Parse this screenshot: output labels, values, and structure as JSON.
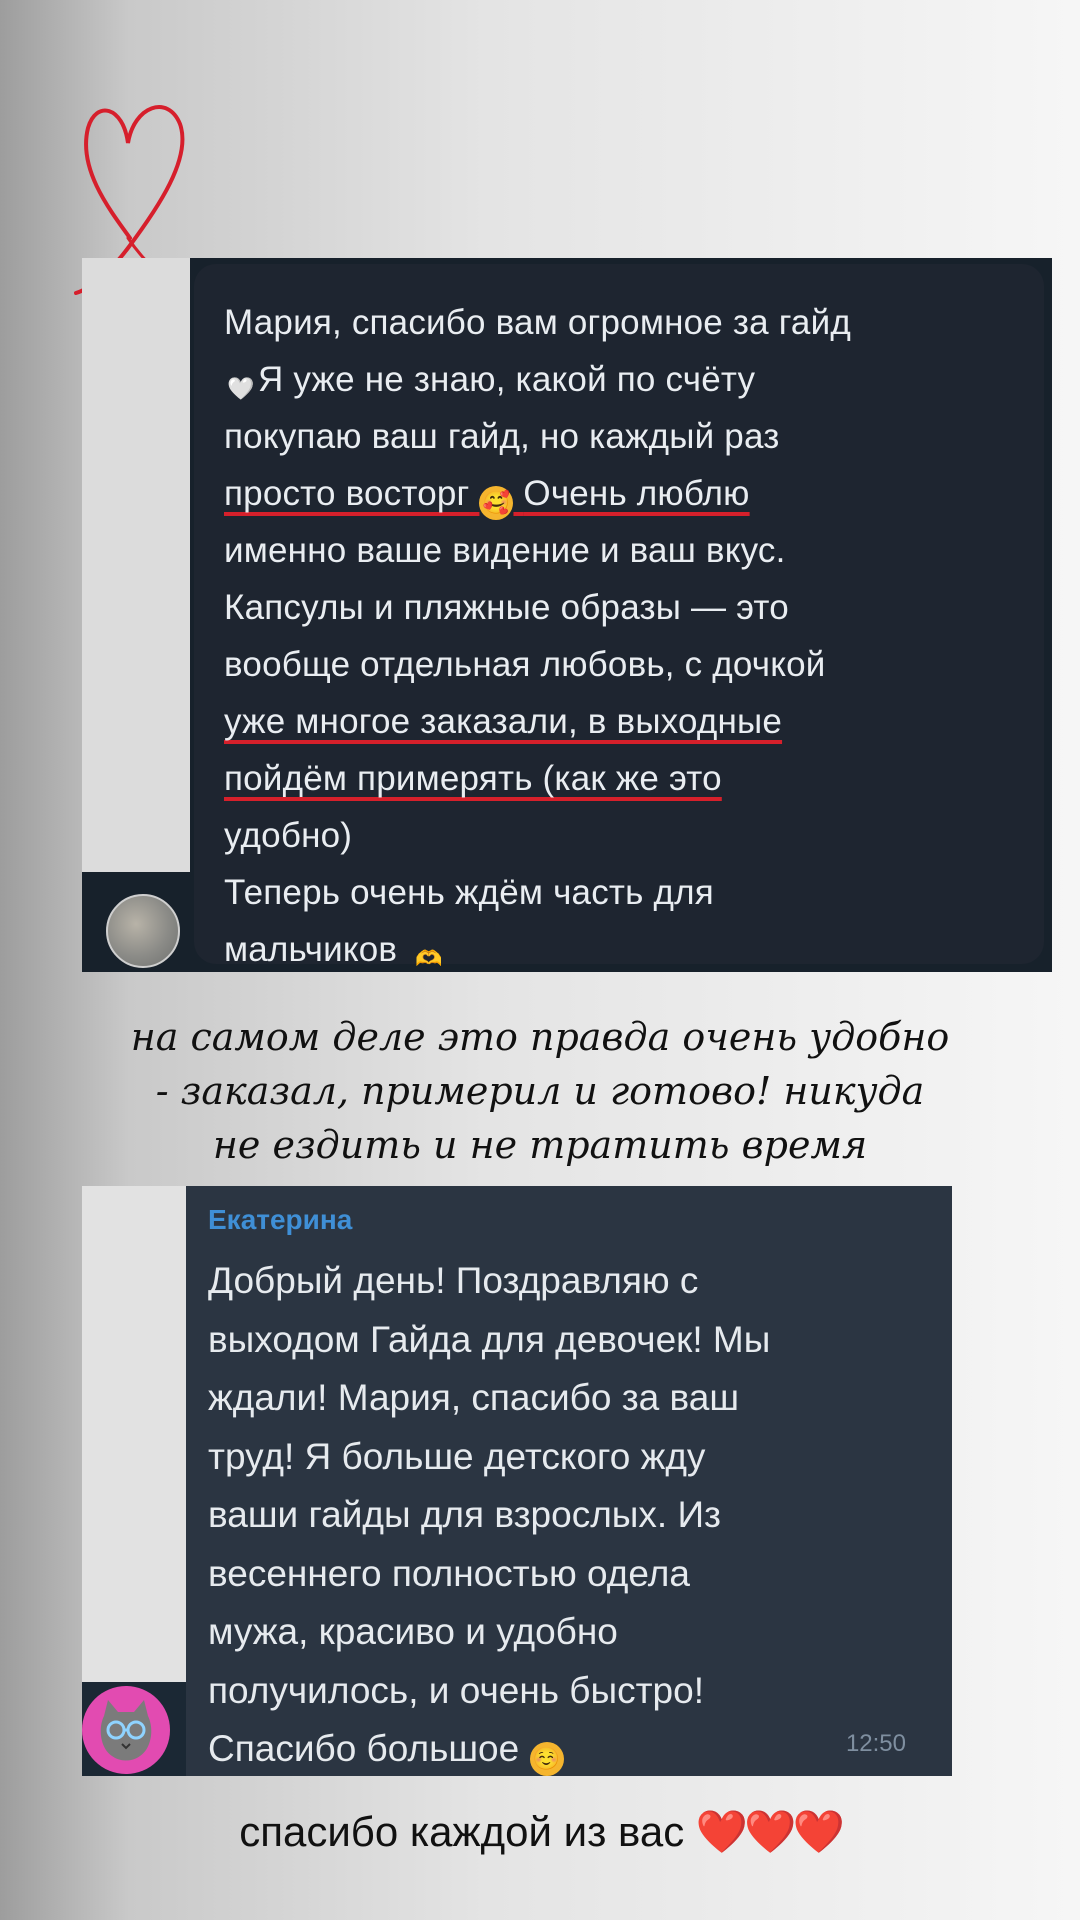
{
  "message1": {
    "lines": [
      "Мария, спасибо вам огромное за гайд",
      "Я уже не знаю, какой по счёту",
      "покупаю ваш гайд, но каждый раз",
      "просто восторг",
      "Очень люблю",
      "именно ваше видение и ваш вкус.",
      "Капсулы и пляжные образы — это",
      "вообще отдельная любовь, с дочкой",
      "уже многое заказали, в выходные",
      "пойдём примерять (как же это",
      "удобно)",
      "Теперь очень ждём часть для",
      "мальчиков"
    ],
    "emoji": {
      "heart": "🤍",
      "smile": "🥰",
      "hands": "🫶"
    }
  },
  "handwriting": {
    "lines": [
      "на самом деле это правда очень удобно",
      "- заказал, примерил и готово! никуда",
      "не ездить и не тратить время"
    ]
  },
  "message2": {
    "sender": "Екатерина",
    "lines": [
      "Добрый день! Поздравляю с",
      "выходом Гайда для девочек! Мы",
      "ждали! Мария, спасибо за ваш",
      "труд! Я больше детского жду",
      "ваши гайды для взрослых. Из",
      "весеннего полностью одела",
      "мужа, красиво и удобно",
      "получилось, и очень быстро!",
      "Спасибо большое"
    ],
    "emoji": "☺️",
    "time": "12:50"
  },
  "footer": {
    "text": "спасибо каждой из вас",
    "hearts": "❤️❤️❤️"
  },
  "colors": {
    "underline": "#d6202b",
    "sender": "#3f8fd6",
    "doodle": "#d61f2c"
  }
}
